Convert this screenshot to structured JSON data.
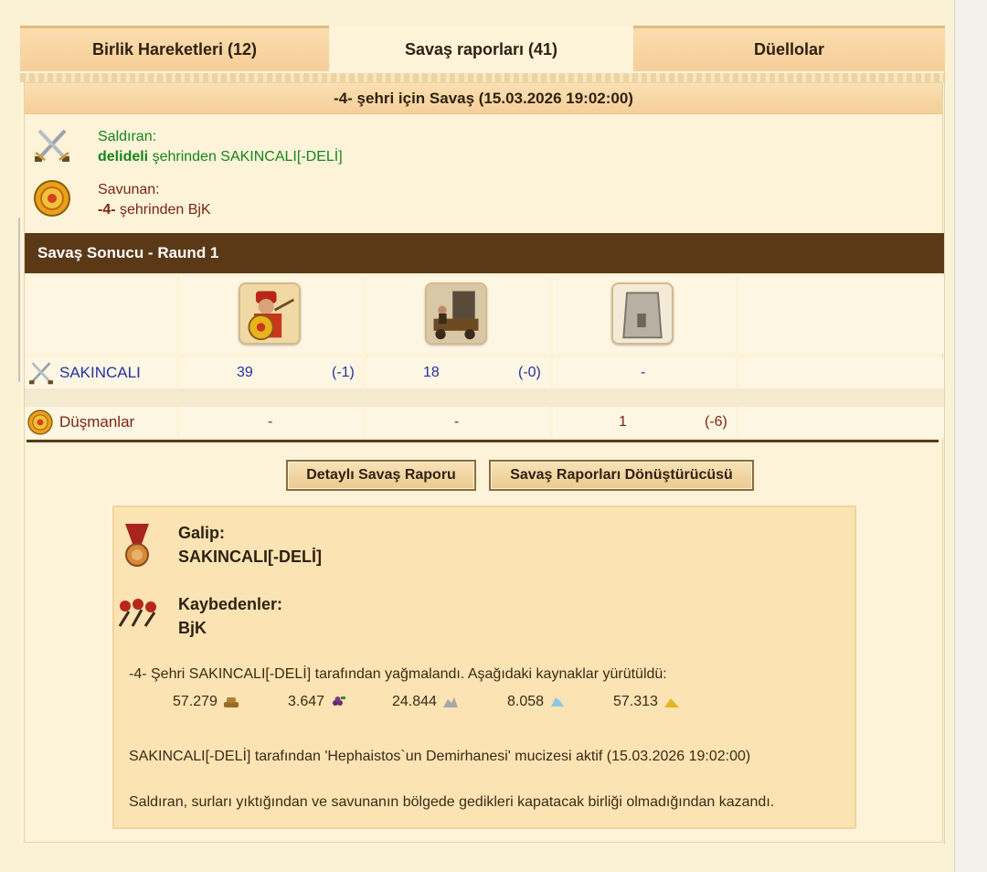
{
  "tabs": [
    {
      "label": "Birlik Hareketleri (12)"
    },
    {
      "label": "Savaş raporları (41)"
    },
    {
      "label": "Düellolar"
    }
  ],
  "report": {
    "title": "-4- şehri için Savaş (15.03.2026 19:02:00)",
    "attacker": {
      "role": "Saldıran:",
      "city": "delideli",
      "from_text": " şehrinden SAKINCALI[-DELİ]"
    },
    "defender": {
      "role": "Savunan:",
      "city": "-4-",
      "from_text": " şehrinden BjK"
    },
    "round_title": "Savaş Sonucu - Raund 1",
    "rows": [
      {
        "name": "SAKINCALI",
        "cells": [
          "39",
          "(-1)",
          "18",
          "(-0)",
          "-"
        ]
      },
      {
        "name": "Düşmanlar",
        "cells": [
          "-",
          "-",
          "1",
          "(-6)"
        ]
      }
    ],
    "buttons": {
      "detail": "Detaylı Savaş Raporu",
      "converter": "Savaş Raporları Dönüştürücüsü"
    },
    "winner_label": "Galip:",
    "winner_name": "SAKINCALI[-DELİ]",
    "losers_label": "Kaybedenler:",
    "losers_name": "BjK",
    "plunder_text": "-4- Şehri SAKINCALI[-DELİ] tarafından yağmalandı. Aşağıdaki kaynaklar yürütüldü:",
    "resources": [
      {
        "value": "57.279",
        "icon": "wood-icon"
      },
      {
        "value": "3.647",
        "icon": "wine-icon"
      },
      {
        "value": "24.844",
        "icon": "marble-icon"
      },
      {
        "value": "8.058",
        "icon": "crystal-icon"
      },
      {
        "value": "57.313",
        "icon": "sulfur-icon"
      }
    ],
    "wonder_text": "SAKINCALI[-DELİ] tarafından 'Hephaistos`un Demirhanesi' mucizesi aktif (15.03.2026 19:02:00)",
    "conclusion_text": "Saldıran, surları yıktığından ve savunanın bölgede gedikleri kapatacak birliği olmadığından kazandı."
  }
}
